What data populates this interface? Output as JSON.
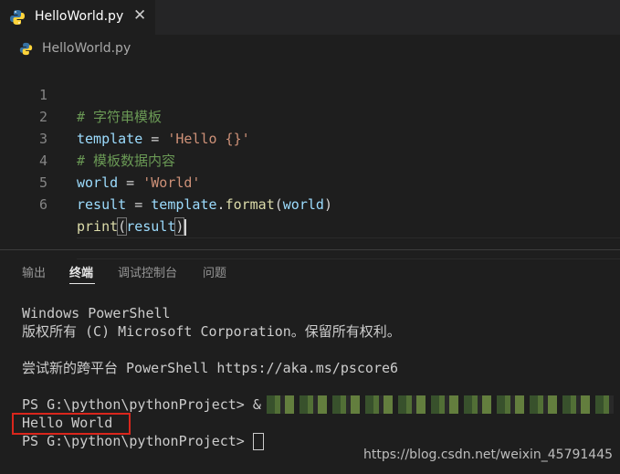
{
  "tab": {
    "title": "HelloWorld.py",
    "close_glyph": "✕"
  },
  "breadcrumb": {
    "file": "HelloWorld.py"
  },
  "editor": {
    "lines": [
      {
        "number": "1",
        "text": "# 字符串模板"
      },
      {
        "number": "2",
        "text": "template = 'Hello {}'"
      },
      {
        "number": "3",
        "text": "# 模板数据内容"
      },
      {
        "number": "4",
        "text": "world = 'World'"
      },
      {
        "number": "5",
        "text": "result = template.format(world)"
      },
      {
        "number": "6",
        "text": "print(result)"
      }
    ]
  },
  "panel": {
    "tabs": [
      "输出",
      "终端",
      "调试控制台",
      "问题"
    ],
    "active_tab": "终端"
  },
  "terminal": {
    "lines": [
      "Windows PowerShell",
      "版权所有 (C) Microsoft Corporation。保留所有权利。",
      "",
      "尝试新的跨平台 PowerShell https://aka.ms/pscore6",
      "",
      "PS G:\\python\\pythonProject> &",
      "Hello World",
      "PS G:\\python\\pythonProject> "
    ]
  },
  "watermark": "https://blog.csdn.net/weixin_45791445",
  "colors": {
    "background": "#1e1e1e",
    "comment": "#6a9955",
    "string": "#ce9178",
    "highlight_box": "#d9261c"
  }
}
